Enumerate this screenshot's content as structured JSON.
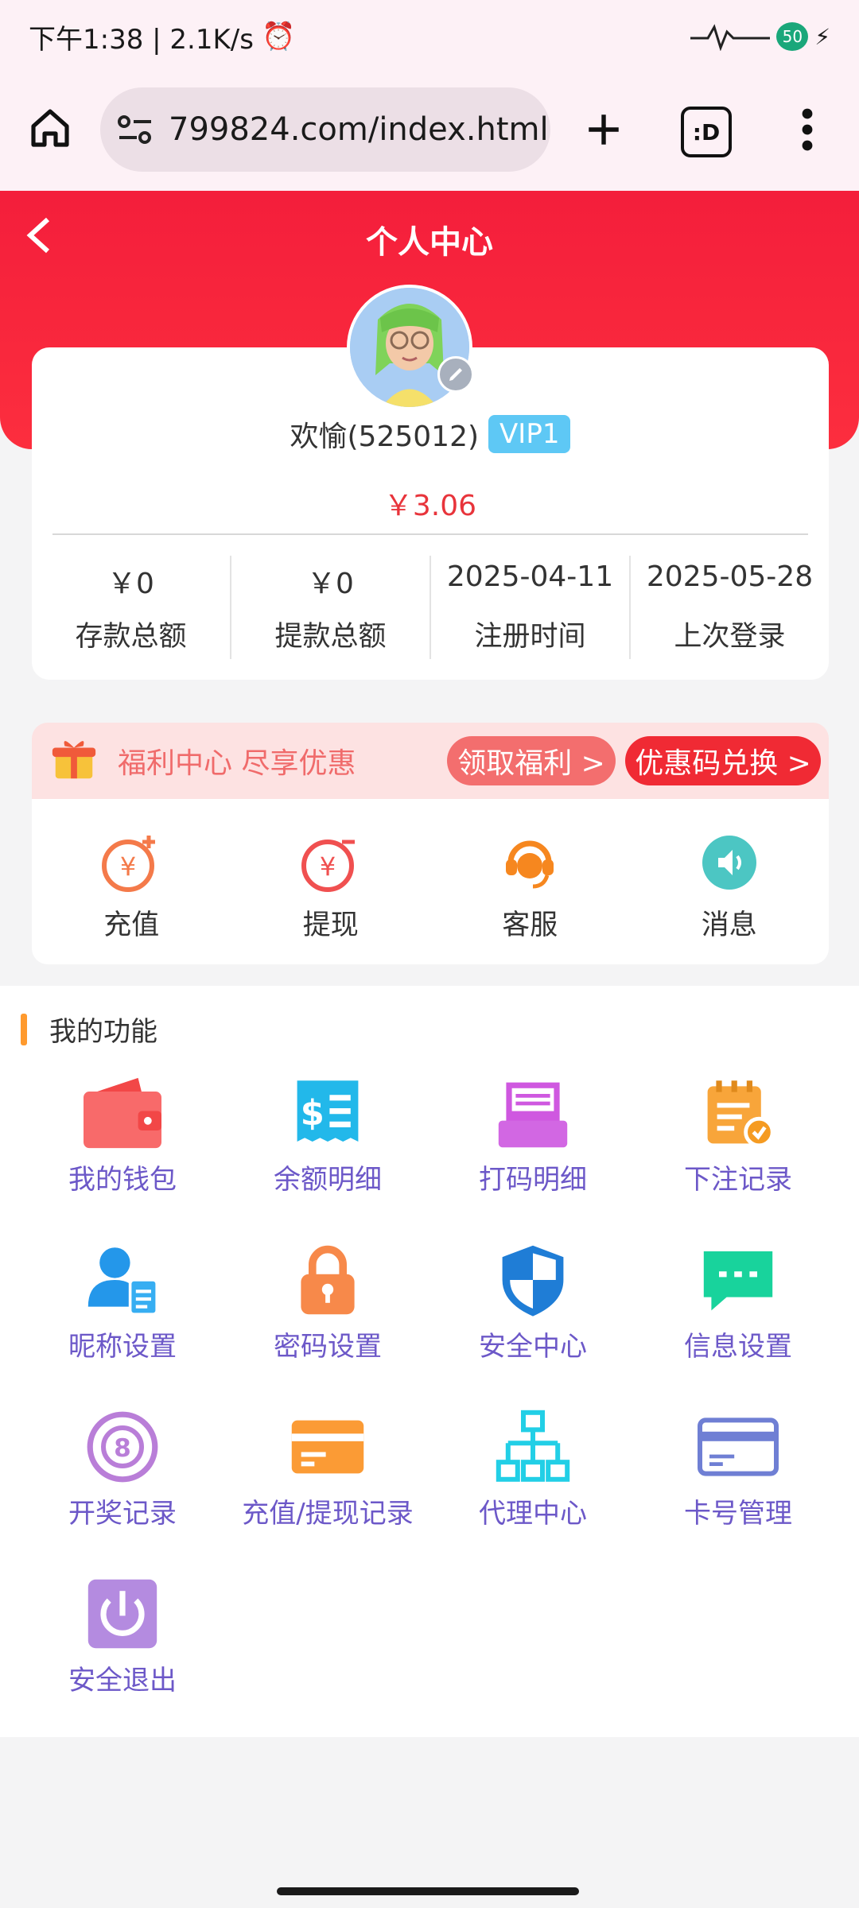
{
  "status_bar": {
    "time_speed": "下午1:38 | 2.1K/s",
    "battery": "50"
  },
  "browser": {
    "url": "799824.com/index.html#"
  },
  "header": {
    "title": "个人中心"
  },
  "profile": {
    "name": "欢愉(525012)",
    "vip": "VIP1",
    "balance": "￥3.06",
    "stats": [
      {
        "value": "￥0",
        "label": "存款总额"
      },
      {
        "value": "￥0",
        "label": "提款总额"
      },
      {
        "value": "2025-04-11",
        "label": "注册时间"
      },
      {
        "value": "2025-05-28",
        "label": "上次登录"
      }
    ]
  },
  "welfare": {
    "text": "福利中心 尽享优惠",
    "claim_label": "领取福利 >",
    "coupon_label": "优惠码兑换 >"
  },
  "quick_actions": [
    {
      "label": "充值",
      "icon": "recharge-icon"
    },
    {
      "label": "提现",
      "icon": "withdraw-icon"
    },
    {
      "label": "客服",
      "icon": "customer-service-icon"
    },
    {
      "label": "消息",
      "icon": "message-icon"
    }
  ],
  "functions": {
    "title": "我的功能",
    "items": [
      {
        "label": "我的钱包",
        "icon": "wallet-icon"
      },
      {
        "label": "余额明细",
        "icon": "balance-detail-icon"
      },
      {
        "label": "打码明细",
        "icon": "wagering-detail-icon"
      },
      {
        "label": "下注记录",
        "icon": "bet-record-icon"
      },
      {
        "label": "昵称设置",
        "icon": "nickname-icon"
      },
      {
        "label": "密码设置",
        "icon": "lock-icon"
      },
      {
        "label": "安全中心",
        "icon": "shield-icon"
      },
      {
        "label": "信息设置",
        "icon": "chat-icon"
      },
      {
        "label": "开奖记录",
        "icon": "lottery-ball-icon"
      },
      {
        "label": "充值/提现记录",
        "icon": "card-record-icon"
      },
      {
        "label": "代理中心",
        "icon": "org-chart-icon"
      },
      {
        "label": "卡号管理",
        "icon": "bank-card-icon"
      },
      {
        "label": "安全退出",
        "icon": "power-icon"
      }
    ]
  },
  "colors": {
    "header_red": "#f41e3b",
    "vip_blue": "#5ec8f5",
    "balance_red": "#e8343b",
    "function_label_purple": "#6c58c8"
  }
}
